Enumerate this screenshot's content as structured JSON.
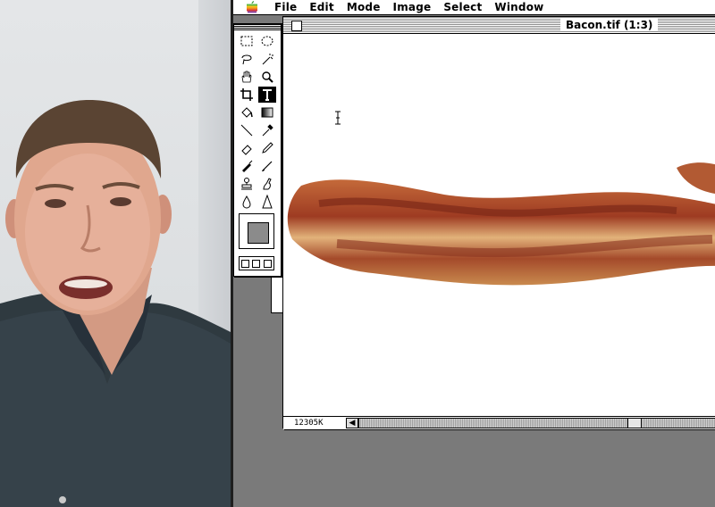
{
  "menubar": {
    "apple_icon": "apple-logo-icon",
    "items": [
      "File",
      "Edit",
      "Mode",
      "Image",
      "Select",
      "Window"
    ]
  },
  "document": {
    "title": "Bacon.tif  (1:3)",
    "size_readout": "12305K"
  },
  "toolbox": {
    "tools": [
      "rectangular-marquee-icon",
      "elliptical-marquee-icon",
      "lasso-icon",
      "magic-wand-icon",
      "hand-icon",
      "zoom-icon",
      "crop-icon",
      "type-icon",
      "paint-bucket-icon",
      "gradient-icon",
      "line-icon",
      "eyedropper-icon",
      "eraser-icon",
      "pencil-icon",
      "airbrush-icon",
      "paintbrush-icon",
      "rubber-stamp-icon",
      "smudge-icon",
      "blur-icon",
      "sharpen-icon"
    ],
    "selected_tool": "type-icon",
    "foreground_color": "#8b8b8b"
  },
  "colors": {
    "desktop": "#7a7a7a",
    "window": "#ffffff"
  }
}
